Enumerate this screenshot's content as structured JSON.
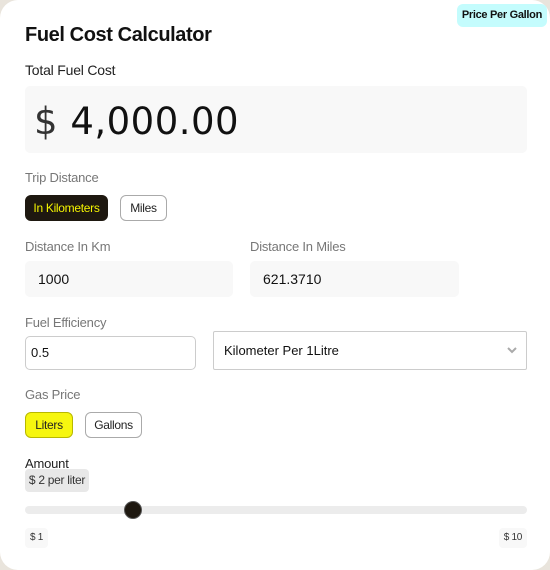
{
  "header": {
    "title": "Fuel Cost Calculator",
    "badge": "Price Per Gallon"
  },
  "total": {
    "label": "Total Fuel Cost",
    "currency": "$",
    "value": "4,000.00"
  },
  "trip_distance": {
    "label": "Trip Distance",
    "options": [
      {
        "label": "In Kilometers",
        "selected": true
      },
      {
        "label": "Miles",
        "selected": false
      }
    ]
  },
  "distances": {
    "km_label": "Distance In Km",
    "km_value": "1000",
    "miles_label": "Distance In Miles",
    "miles_value": "621.3710"
  },
  "fuel_efficiency": {
    "label": "Fuel Efficiency",
    "value": "0.5",
    "unit_selected": "Kilometer Per 1Litre"
  },
  "gas_price": {
    "label": "Gas Price",
    "options": [
      {
        "label": "Liters",
        "selected": true
      },
      {
        "label": "Gallons",
        "selected": false
      }
    ]
  },
  "amount": {
    "label": "Amount",
    "display": "$ 2  per liter",
    "slider_value": 2,
    "min": 1,
    "max": 10,
    "min_label": "$ 1",
    "max_label": "$ 10"
  },
  "colors": {
    "selected_dark": "#1e1810",
    "accent_yellow": "#f6f60f",
    "badge_cyan": "#c4fcfd"
  }
}
